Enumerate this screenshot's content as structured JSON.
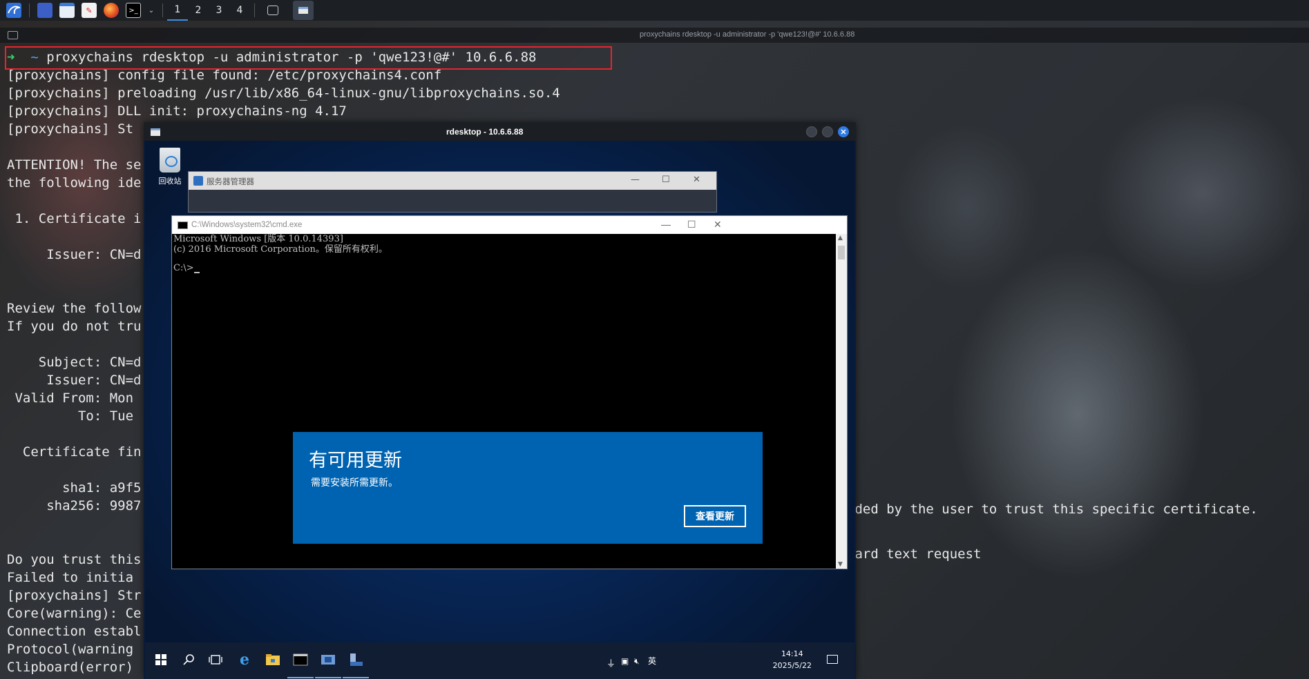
{
  "topbar": {
    "workspaces": [
      "1",
      "2",
      "3",
      "4"
    ]
  },
  "terminal": {
    "title": "proxychains rdesktop -u administrator -p 'qwe123!@#' 10.6.6.88",
    "prompt_arrow": "➜",
    "prompt_dir": "~",
    "command": "proxychains rdesktop -u administrator -p 'qwe123!@#' 10.6.6.88",
    "lines": [
      "[proxychains] config file found: /etc/proxychains4.conf",
      "[proxychains] preloading /usr/lib/x86_64-linux-gnu/libproxychains.so.4",
      "[proxychains] DLL init: proxychains-ng 4.17",
      "[proxychains] St",
      "",
      "ATTENTION! The se",
      "the following ide",
      "",
      " 1. Certificate i",
      "",
      "     Issuer: CN=d",
      "",
      "",
      "Review the follow",
      "If you do not tru",
      "",
      "    Subject: CN=d",
      "     Issuer: CN=d",
      " Valid From: Mon ",
      "         To: Tue ",
      "",
      "  Certificate fin",
      "",
      "       sha1: a9f5",
      "     sha256: 9987",
      "",
      "",
      "Do you trust this",
      "Failed to initia",
      "[proxychains] Str",
      "Core(warning): Ce",
      "Connection establ",
      "Protocol(warning",
      "Clipboard(error)"
    ],
    "right_fragment_1": "dded by the user to trust this specific certificate.",
    "right_fragment_2": "oard text request"
  },
  "rdesktop": {
    "title": "rdesktop - 10.6.6.88",
    "desktop": {
      "recycle_label": "回收站"
    },
    "server_manager": {
      "title": "服务器管理器"
    },
    "cmd": {
      "title": "C:\\Windows\\system32\\cmd.exe",
      "line1": "Microsoft Windows [版本 10.0.14393]",
      "line2": "(c) 2016 Microsoft Corporation。保留所有权利。",
      "prompt": "C:\\>"
    },
    "update": {
      "title": "有可用更新",
      "message": "需要安装所需更新。",
      "button": "查看更新"
    },
    "taskbar": {
      "tray_lang": "英",
      "time": "14:14",
      "date": "2025/5/22"
    }
  }
}
